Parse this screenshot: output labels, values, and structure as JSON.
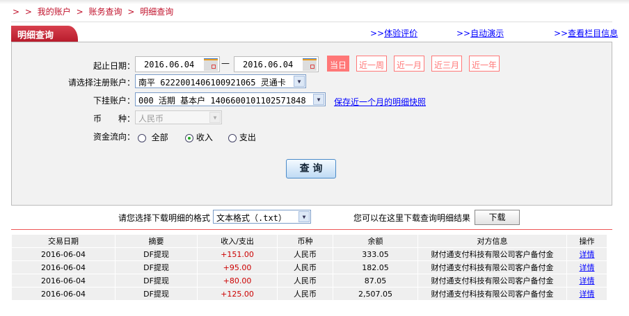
{
  "breadcrumb": {
    "sep": ">",
    "items": [
      "我的账户",
      "账务查询",
      "明细查询"
    ]
  },
  "tab": {
    "title": "明细查询"
  },
  "links": [
    {
      "prefix": ">>",
      "label": "体验评价"
    },
    {
      "prefix": ">>",
      "label": "自动演示"
    },
    {
      "prefix": ">>",
      "label": "查看栏目信息"
    }
  ],
  "form": {
    "date_label": "起止日期：",
    "start_date": "2016.06.04",
    "dash": "—",
    "end_date": "2016.06.04",
    "quick_ranges": [
      "当日",
      "近一周",
      "近一月",
      "近三月",
      "近一年"
    ],
    "active_range": "当日",
    "account_label": "请选择注册账户：",
    "account_value": "南平 6222001406100921065 灵通卡",
    "sub_label": "下挂账户：",
    "sub_value": "000 活期 基本户 1406600101102571848",
    "snapshot_link": "保存近一个月的明细快照",
    "currency_label": "币　　种：",
    "currency_value": "人民币",
    "flow_label": "资金流向：",
    "flow_options": [
      "全部",
      "收入",
      "支出"
    ],
    "flow_selected": "收入",
    "query_button": "查 询"
  },
  "download": {
    "format_label": "请您选择下载明细的格式",
    "format_value": "文本格式（.txt）",
    "hint": "您可以在这里下载查询明细结果",
    "button": "下载"
  },
  "table": {
    "headers": [
      "交易日期",
      "摘要",
      "收入/支出",
      "币种",
      "余额",
      "对方信息",
      "操作"
    ],
    "rows": [
      [
        "2016-06-04",
        "DF提现",
        "+151.00",
        "人民币",
        "333.05",
        "财付通支付科技有限公司客户备付金",
        "详情"
      ],
      [
        "2016-06-04",
        "DF提现",
        "+95.00",
        "人民币",
        "182.05",
        "财付通支付科技有限公司客户备付金",
        "详情"
      ],
      [
        "2016-06-04",
        "DF提现",
        "+80.00",
        "人民币",
        "87.05",
        "财付通支付科技有限公司客户备付金",
        "详情"
      ],
      [
        "2016-06-04",
        "DF提现",
        "+125.00",
        "人民币",
        "2,507.05",
        "财付通支付科技有限公司客户备付金",
        "详情"
      ]
    ]
  },
  "colors": {
    "brand_red": "#c0102a",
    "quick_btn": "#ff7777",
    "income": "#cc0000",
    "link": "#0000ff"
  }
}
